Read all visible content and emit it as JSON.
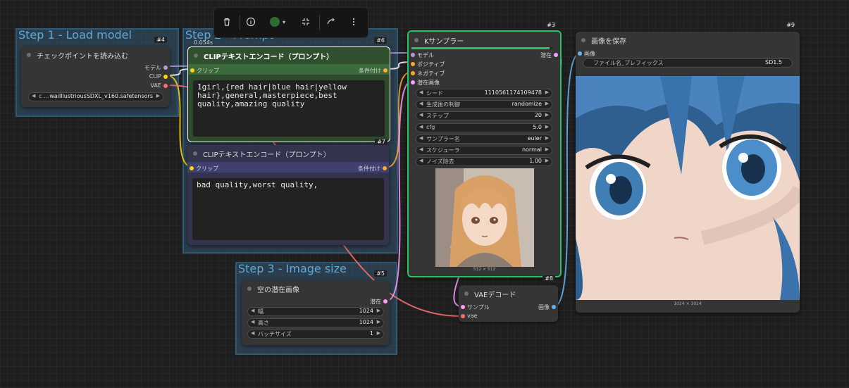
{
  "toolbar": {
    "items": [
      {
        "name": "delete-icon"
      },
      {
        "name": "info-icon"
      },
      {
        "name": "color-picker",
        "color": "#2e6b34"
      },
      {
        "name": "collapse-icon"
      },
      {
        "name": "bypass-icon"
      },
      {
        "name": "more-icon"
      }
    ]
  },
  "timing": "0.054s",
  "groups": {
    "step1": "Step 1 - Load model",
    "step2": "Step 2 - Prompt",
    "step3": "Step 3 - Image size"
  },
  "nodes": {
    "checkpoint": {
      "id": "#4",
      "title": "チェックポイントを読み込む",
      "outputs": {
        "model": "モデル",
        "clip": "CLIP",
        "vae": "VAE"
      },
      "ckpt_prefix": "c ...",
      "ckpt_name": "waiIllustriousSDXL_v160.safetensors"
    },
    "clip_pos": {
      "id": "#6",
      "title": "CLIPテキストエンコード（プロンプト）",
      "input": "クリップ",
      "output": "条件付け",
      "text": "1girl,{red hair|blue hair|yellow hair},general,masterpiece,best quality,amazing quality"
    },
    "clip_neg": {
      "id": "#7",
      "title": "CLIPテキストエンコード（プロンプト）",
      "input": "クリップ",
      "output": "条件付け",
      "text": "bad quality,worst quality,"
    },
    "empty_latent": {
      "id": "#5",
      "title": "空の潜在画像",
      "output": "潜在",
      "widgets": [
        {
          "label": "幅",
          "value": "1024"
        },
        {
          "label": "高さ",
          "value": "1024"
        },
        {
          "label": "バッチサイズ",
          "value": "1"
        }
      ]
    },
    "ksampler": {
      "id": "#3",
      "title": "Kサンプラー",
      "inputs": [
        "モデル",
        "ポジティブ",
        "ネガティブ",
        "潜在画像"
      ],
      "output": "潜在",
      "progress": 0.98,
      "widgets": [
        {
          "label": "シード",
          "value": "1110561174109478"
        },
        {
          "label": "生成後の制御",
          "value": "randomize"
        },
        {
          "label": "ステップ",
          "value": "20"
        },
        {
          "label": "cfg",
          "value": "5.0"
        },
        {
          "label": "サンプラー名",
          "value": "euler"
        },
        {
          "label": "スケジューラ",
          "value": "normal"
        },
        {
          "label": "ノイズ除去",
          "value": "1.00"
        }
      ],
      "preview_size": "512 × 512"
    },
    "vae_decode": {
      "id": "#8",
      "title": "VAEデコード",
      "inputs": [
        "サンプル",
        "vae"
      ],
      "output": "画像"
    },
    "save_image": {
      "id": "#9",
      "title": "画像を保存",
      "input": "画像",
      "prefix_label": "ファイル名_プレフィックス",
      "prefix_value": "SD1.5",
      "image_size": "1024 × 1024"
    }
  },
  "colors": {
    "model": "#b39ddb",
    "clip": "#ffd500",
    "vae": "#ff6e6e",
    "conditioning": "#ffa931",
    "latent": "#ff9cf9",
    "image": "#64b5f6",
    "selected": "#ffffff",
    "running": "#22c55e"
  }
}
